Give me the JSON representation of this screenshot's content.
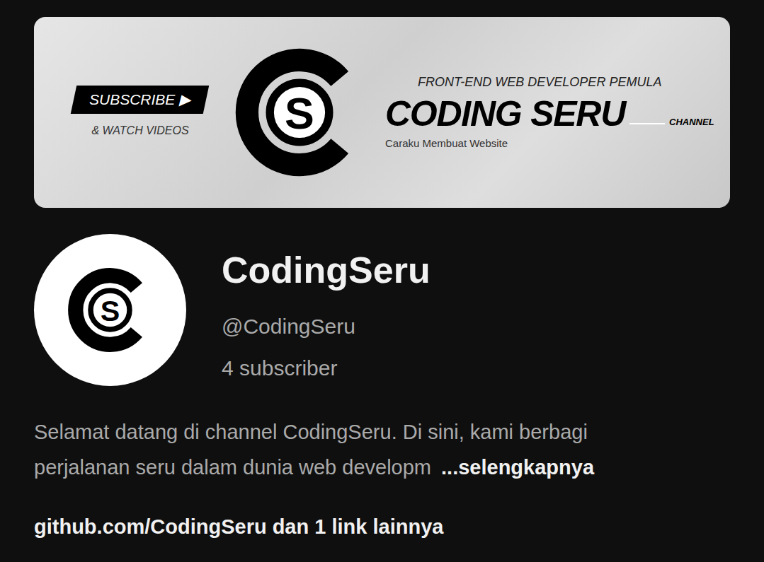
{
  "banner": {
    "subscribe_label": "SUBSCRIBE ▶",
    "watch_label": "& WATCH VIDEOS",
    "logo_letter": "S",
    "tagline": "FRONT-END WEB DEVELOPER PEMULA",
    "title": "CODING SERU",
    "subtitle": "Caraku Membuat Website",
    "channel_label": "CHANNEL"
  },
  "channel": {
    "logo_letter": "S",
    "name": "CodingSeru",
    "handle": "@CodingSeru",
    "subscribers": "4 subscriber",
    "description_lines": [
      "Selamat datang di channel CodingSeru. Di sini, kami berbagi",
      "perjalanan seru dalam dunia web developm"
    ],
    "more_label": "...selengkapnya",
    "link": "github.com/CodingSeru",
    "links_more": "dan 1 link lainnya"
  }
}
